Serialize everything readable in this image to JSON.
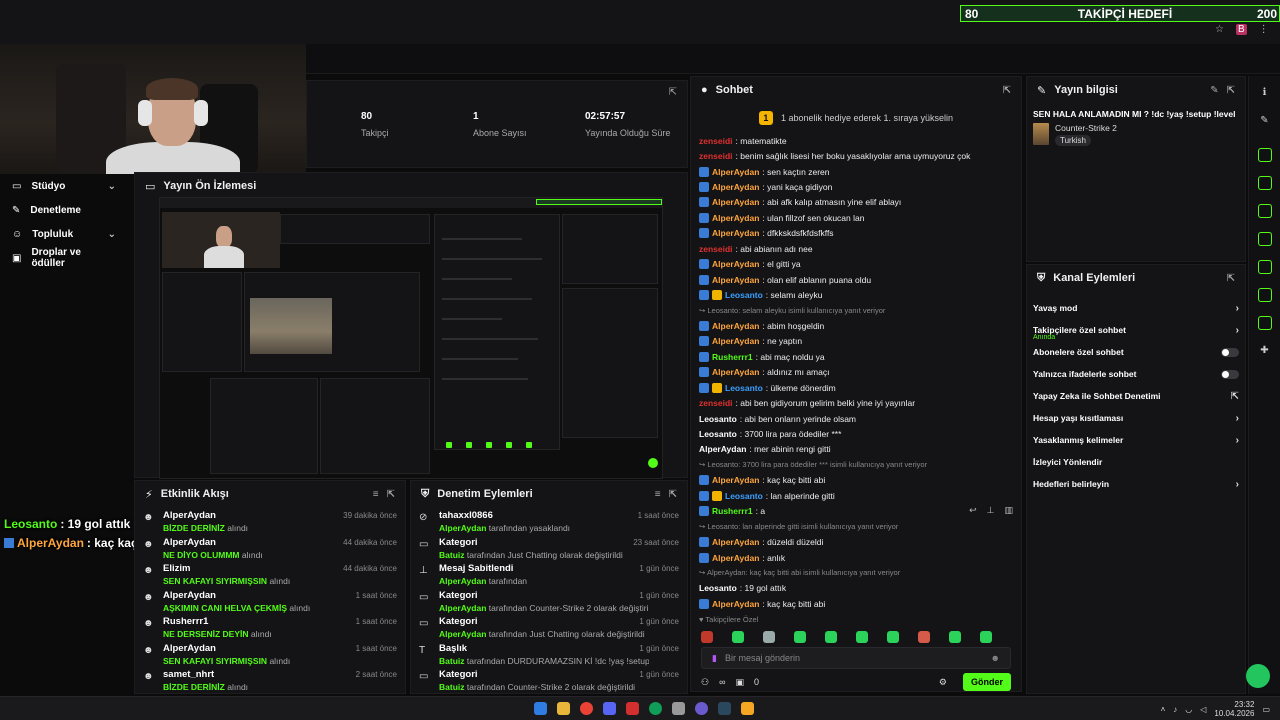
{
  "goal": {
    "current": "80",
    "label": "TAKİPÇİ HEDEFİ",
    "target": "200"
  },
  "stats": [
    {
      "value": "80",
      "label": "Takipçi"
    },
    {
      "value": "1",
      "label": "Abone Sayısı"
    },
    {
      "value": "02:57:57",
      "label": "Yayında Olduğu Süre"
    }
  ],
  "sidebar": {
    "items": [
      {
        "label": "Stüdyo",
        "icon": "monitor-icon"
      },
      {
        "label": "Denetleme",
        "icon": "wrench-icon"
      },
      {
        "label": "Topluluk",
        "icon": "people-icon"
      },
      {
        "label": "Droplar ve ödüller",
        "icon": "gift-icon"
      }
    ]
  },
  "preview": {
    "title": "Yayın Ön İzlemesi"
  },
  "overlay_chat": [
    {
      "user": "Leosanto",
      "text": ": 19 gol attık"
    },
    {
      "user": "AlperAydan",
      "text": ": kaç kaç bitti abi"
    }
  ],
  "activity": {
    "title": "Etkinlik Akışı",
    "items": [
      {
        "name": "AlperAydan",
        "highlight": "BİZDE DERİNİZ",
        "suffix": " alındı",
        "time": "39 dakika önce"
      },
      {
        "name": "AlperAydan",
        "highlight": "NE DİYO OLUMMM",
        "suffix": " alındı",
        "time": "44 dakika önce"
      },
      {
        "name": "Elizim",
        "highlight": "SEN KAFAYI SIYIRMIŞSIN",
        "suffix": " alındı",
        "time": "44 dakika önce"
      },
      {
        "name": "AlperAydan",
        "highlight": "AŞKIMIN CANI HELVA ÇEKMİŞ",
        "suffix": " alındı",
        "time": "1 saat önce"
      },
      {
        "name": "Rusherrr1",
        "highlight": "NE DERSENİZ DEYİN",
        "suffix": " alındı",
        "time": "1 saat önce"
      },
      {
        "name": "AlperAydan",
        "highlight": "SEN KAFAYI SIYIRMIŞSIN",
        "suffix": " alındı",
        "time": "1 saat önce"
      },
      {
        "name": "samet_nhrt",
        "highlight": "BİZDE DERİNİZ",
        "suffix": " alındı",
        "time": "2 saat önce"
      }
    ]
  },
  "moderation": {
    "title": "Denetim Eylemleri",
    "items": [
      {
        "name": "tahaxxl0866",
        "actor": "AlperAydan",
        "rest": " tarafından yasaklandı",
        "time": "1 saat önce"
      },
      {
        "name": "Kategori",
        "actor": "Batuiz",
        "rest": " tarafından Just Chatting olarak değiştirildi",
        "time": "23 saat önce"
      },
      {
        "name": "Mesaj Sabitlendi",
        "actor": "AlperAydan",
        "rest": " tarafından",
        "time": "1 gün önce"
      },
      {
        "name": "Kategori",
        "actor": "AlperAydan",
        "rest": " tarafından Counter-Strike 2 olarak değiştirildi",
        "time": "1 gün önce"
      },
      {
        "name": "Kategori",
        "actor": "AlperAydan",
        "rest": " tarafından Just Chatting olarak değiştirildi",
        "time": "1 gün önce"
      },
      {
        "name": "Başlık",
        "actor": "Batuiz",
        "rest": " tarafından DURDURAMAZSIN Kİ !dc !yaş !setup !level olarak değiştirildi",
        "time": "1 gün önce"
      },
      {
        "name": "Kategori",
        "actor": "Batuiz",
        "rest": " tarafından Counter-Strike 2 olarak değiştirildi",
        "time": "1 gün önce"
      }
    ]
  },
  "chat": {
    "title": "Sohbet",
    "banner": "1 abonelik hediye ederek 1. sıraya yükselin",
    "messages": [
      {
        "user": "zenseidi",
        "cls": "u-red",
        "badge": "",
        "text": ": matematikte"
      },
      {
        "user": "zenseidi",
        "cls": "u-red",
        "badge": "",
        "text": ": benim sağlık lisesi her boku yasaklıyolar ama uymuyoruz çok"
      },
      {
        "user": "AlperAydan",
        "cls": "u-alp",
        "badge": "b",
        "text": ": sen kaçtın zeren"
      },
      {
        "user": "AlperAydan",
        "cls": "u-alp",
        "badge": "b",
        "text": ": yani kaça gidiyon"
      },
      {
        "user": "AlperAydan",
        "cls": "u-alp",
        "badge": "b",
        "text": ": abi afk kalıp atmasın yine elif ablayı"
      },
      {
        "user": "AlperAydan",
        "cls": "u-alp",
        "badge": "b",
        "text": ": ulan fillzof sen okucan lan"
      },
      {
        "user": "AlperAydan",
        "cls": "u-alp",
        "badge": "b",
        "text": ": dfkkskdsfkfdsfkffs"
      },
      {
        "user": "zenseidi",
        "cls": "u-red",
        "badge": "",
        "text": ": abi abianın adı nee"
      },
      {
        "user": "AlperAydan",
        "cls": "u-alp",
        "badge": "b",
        "text": ": el gitti ya"
      },
      {
        "user": "AlperAydan",
        "cls": "u-alp",
        "badge": "b",
        "text": ": olan elif ablanın puana oldu"
      },
      {
        "user": "Leosanto",
        "cls": "u-leo",
        "badge": "bb",
        "text": ": selamı aleyku"
      },
      {
        "reply": "↪ Leosanto: selam aleyku isimli kullanıcıya yanıt veriyor"
      },
      {
        "user": "AlperAydan",
        "cls": "u-alp",
        "badge": "b",
        "text": ": abim hoşgeldin"
      },
      {
        "user": "AlperAydan",
        "cls": "u-alp",
        "badge": "b",
        "text": ": ne yaptın"
      },
      {
        "user": "Rusherrr1",
        "cls": "u-rus",
        "badge": "b",
        "text": ": abi maç noldu ya"
      },
      {
        "user": "AlperAydan",
        "cls": "u-alp",
        "badge": "b",
        "text": ": aldınız mı amaçı"
      },
      {
        "user": "Leosanto",
        "cls": "u-leo",
        "badge": "bb",
        "text": ": ülkeme dönerdim"
      },
      {
        "user": "zenseidi",
        "cls": "u-red",
        "badge": "",
        "text": ": abi ben gidiyorum gelirim belki yine iyi yayınlar"
      },
      {
        "user": "Leosanto",
        "cls": "u-leow",
        "badge": "",
        "text": ": abi ben onların yerinde olsam"
      },
      {
        "user": "Leosanto",
        "cls": "u-leow",
        "badge": "",
        "text": ": 3700 lira para ödediler ***"
      },
      {
        "user": "AlperAydan",
        "cls": "u-leow",
        "badge": "",
        "text": ": mer abinin rengi gitti"
      },
      {
        "reply": "↪ Leosanto: 3700 lira para ödediler *** isimli kullanıcıya yanıt veriyor"
      },
      {
        "user": "AlperAydan",
        "cls": "u-alp",
        "badge": "b",
        "text": ": kaç kaç bitti abi"
      },
      {
        "user": "Leosanto",
        "cls": "u-leo",
        "badge": "bb",
        "text": ": lan alperinde gitti"
      },
      {
        "user": "Rusherrr1",
        "cls": "u-rus",
        "badge": "b",
        "text": ": a"
      },
      {
        "reply": "↪ Leosanto: lan alperinde gitti isimli kullanıcıya yanıt veriyor"
      },
      {
        "user": "AlperAydan",
        "cls": "u-alp",
        "badge": "b",
        "text": ": düzeldi düzeldi"
      },
      {
        "user": "AlperAydan",
        "cls": "u-alp",
        "badge": "b",
        "text": ": anlık"
      },
      {
        "reply": "↪ AlperAydan: kaç kaç bitti abi isimli kullanıcıya yanıt veriyor"
      },
      {
        "user": "Leosanto",
        "cls": "u-leow",
        "badge": "",
        "text": ": 19 gol attık"
      },
      {
        "user": "AlperAydan",
        "cls": "u-alp",
        "badge": "b",
        "text": ": kaç kaç bitti abi"
      },
      {
        "reply": "♥ Takipçilere Özel"
      }
    ],
    "placeholder": "Bir mesaj gönderin",
    "viewers": "∞",
    "count": "0",
    "send": "Gönder"
  },
  "streaminfo": {
    "title": "Yayın bilgisi",
    "stream_title": "SEN HALA ANLAMADIN MI ? !dc !yaş !setup !level",
    "game": "Counter-Strike 2",
    "tag": "Turkish"
  },
  "actions": {
    "title": "Kanal Eylemleri",
    "items": [
      {
        "label": "Yavaş mod",
        "type": "arrow"
      },
      {
        "label": "Takipçilere özel sohbet",
        "type": "arrow",
        "sub": "Anında"
      },
      {
        "label": "Abonelere özel sohbet",
        "type": "toggle"
      },
      {
        "label": "Yalnızca ifadelerle sohbet",
        "type": "toggle"
      },
      {
        "label": "Yapay Zeka ile Sohbet Denetimi",
        "type": "ext"
      },
      {
        "label": "Hesap yaşı kısıtlaması",
        "type": "arrow"
      },
      {
        "label": "Yasaklanmış kelimeler",
        "type": "arrow"
      },
      {
        "label": "İzleyici Yönlendir",
        "type": "none"
      },
      {
        "label": "Hedefleri belirleyin",
        "type": "arrow"
      }
    ]
  },
  "tray": {
    "time": "23:32",
    "date": "10.04.2026"
  },
  "colors": {
    "accent": "#53fc18",
    "bg": "#141416"
  }
}
